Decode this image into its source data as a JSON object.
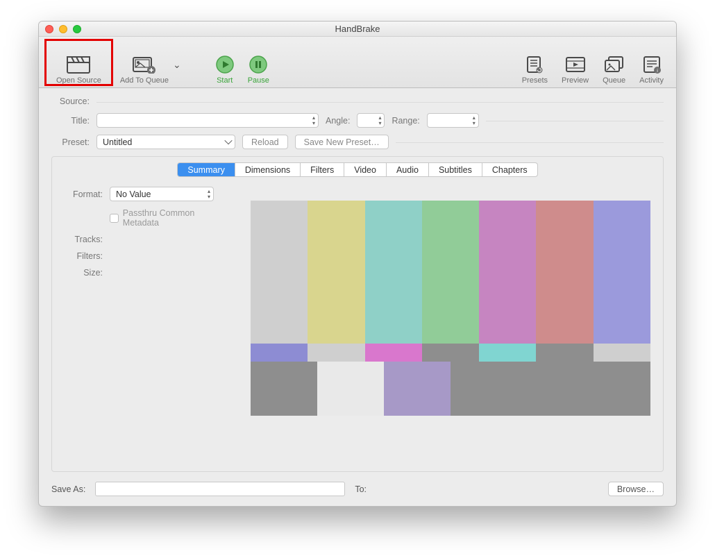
{
  "window": {
    "title": "HandBrake"
  },
  "toolbar": {
    "open_source": "Open Source",
    "add_to_queue": "Add To Queue",
    "start": "Start",
    "pause": "Pause",
    "presets": "Presets",
    "preview": "Preview",
    "queue": "Queue",
    "activity": "Activity"
  },
  "labels": {
    "source": "Source:",
    "title": "Title:",
    "angle": "Angle:",
    "range": "Range:",
    "preset": "Preset:",
    "reload": "Reload",
    "save_new_preset": "Save New Preset…",
    "format": "Format:",
    "passthru": "Passthru Common Metadata",
    "tracks": "Tracks:",
    "filters": "Filters:",
    "size": "Size:",
    "save_as": "Save As:",
    "to": "To:",
    "browse": "Browse…"
  },
  "values": {
    "preset": "Untitled",
    "format": "No Value",
    "title": "",
    "angle": "",
    "range": "",
    "save_as": ""
  },
  "tabs": [
    "Summary",
    "Dimensions",
    "Filters",
    "Video",
    "Audio",
    "Subtitles",
    "Chapters"
  ],
  "active_tab": "Summary",
  "preview_bars": {
    "main": [
      "#cfcfcf",
      "#d9d58e",
      "#8fd0c7",
      "#91cc98",
      "#c685c1",
      "#cf8c8c",
      "#9b9adc"
    ],
    "mid": [
      "#8d8cd3",
      "#cfcfcf",
      "#d977cd",
      "#8e8e8e",
      "#80d5d1",
      "#8e8e8e",
      "#cfcfcf"
    ],
    "bot": [
      "#8e8e8e",
      "#e9e9e9",
      "#a799c7",
      "#8e8e8e",
      "#8e8e8e",
      "#8e8e8e"
    ]
  }
}
